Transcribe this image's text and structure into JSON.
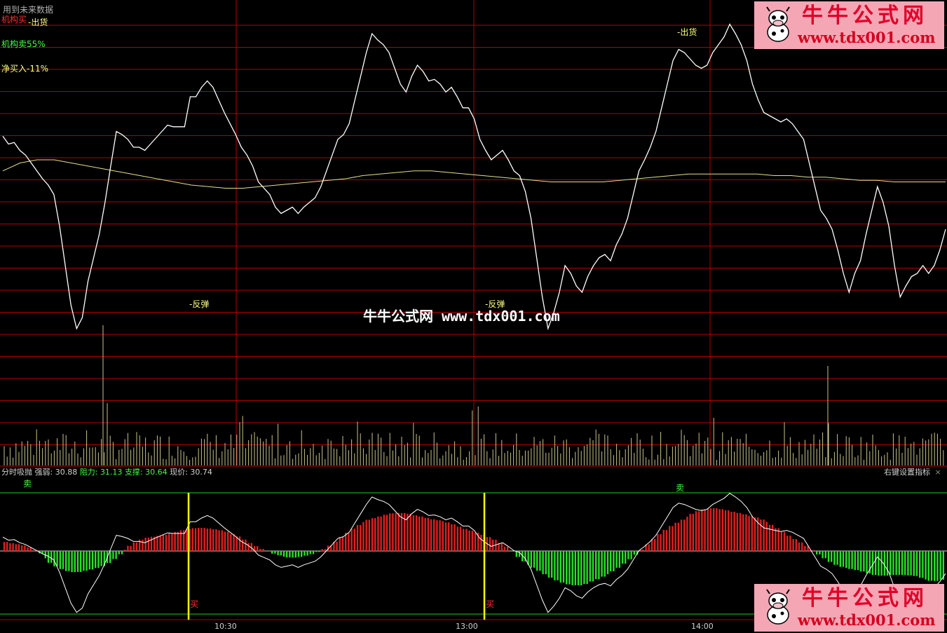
{
  "hint_text": "用到未来数据",
  "legend": {
    "inst_buy_label": "机构买",
    "inst_sell_label": "机构卖55%",
    "net_buy_label": "净买入-11%"
  },
  "signals": {
    "sell_top": "出货",
    "sell_left": "出货",
    "rebound1": "反弹",
    "rebound2": "反弹"
  },
  "watermark": "牛牛公式网 www.tdx001.com",
  "logo": {
    "cn": "牛牛公式网",
    "url": "www.tdx001.com"
  },
  "indicator": {
    "name": "分时吸抛",
    "strength_label": "强弱:",
    "strength_value": "30.88",
    "resistance_label": "阻力:",
    "resistance_value": "31.13",
    "support_label": "支撑:",
    "support_value": "30.64",
    "price_label": "现价:",
    "price_value": "30.74",
    "right_menu": "右键设置指标",
    "close_symbol": "×",
    "sell_mark": "卖",
    "buy_mark": "买"
  },
  "colors": {
    "grid": "#b40000",
    "price": "#ffffff",
    "avg": "#e6e08c",
    "volume": "#c8c48a",
    "bar_up": "#e02020",
    "bar_down": "#28e028",
    "band": "#20d020",
    "signal_line": "#ffff00",
    "label_yellow": "#ffff80",
    "label_green": "#40ff40",
    "label_red": "#ff3030"
  },
  "chart_data": {
    "type": "line",
    "x_ticks": [
      "10:30",
      "13:00",
      "14:00"
    ],
    "price_series_norm": [
      0.27,
      0.22,
      0.23,
      0.18,
      0.15,
      0.1,
      0.05,
      0.0,
      -0.04,
      -0.1,
      -0.3,
      -0.55,
      -0.8,
      -0.95,
      -0.88,
      -0.65,
      -0.5,
      -0.35,
      -0.15,
      0.08,
      0.3,
      0.28,
      0.25,
      0.2,
      0.2,
      0.18,
      0.22,
      0.26,
      0.3,
      0.34,
      0.33,
      0.33,
      0.33,
      0.52,
      0.52,
      0.58,
      0.62,
      0.58,
      0.5,
      0.42,
      0.35,
      0.28,
      0.2,
      0.15,
      0.08,
      -0.02,
      -0.06,
      -0.1,
      -0.18,
      -0.22,
      -0.2,
      -0.18,
      -0.22,
      -0.18,
      -0.15,
      -0.12,
      -0.05,
      0.05,
      0.15,
      0.25,
      0.28,
      0.35,
      0.5,
      0.65,
      0.8,
      0.92,
      0.88,
      0.85,
      0.8,
      0.7,
      0.6,
      0.55,
      0.65,
      0.72,
      0.68,
      0.62,
      0.63,
      0.6,
      0.55,
      0.58,
      0.52,
      0.45,
      0.45,
      0.38,
      0.25,
      0.18,
      0.12,
      0.15,
      0.18,
      0.12,
      0.05,
      0.02,
      -0.08,
      -0.25,
      -0.5,
      -0.75,
      -0.95,
      -0.85,
      -0.72,
      -0.55,
      -0.6,
      -0.68,
      -0.72,
      -0.62,
      -0.55,
      -0.5,
      -0.48,
      -0.52,
      -0.42,
      -0.35,
      -0.25,
      -0.1,
      0.05,
      0.12,
      0.2,
      0.3,
      0.45,
      0.6,
      0.75,
      0.82,
      0.8,
      0.76,
      0.72,
      0.7,
      0.72,
      0.8,
      0.85,
      0.9,
      0.98,
      0.92,
      0.85,
      0.75,
      0.6,
      0.5,
      0.42,
      0.4,
      0.38,
      0.36,
      0.38,
      0.35,
      0.3,
      0.25,
      0.1,
      -0.05,
      -0.2,
      -0.25,
      -0.32,
      -0.45,
      -0.6,
      -0.72,
      -0.6,
      -0.52,
      -0.35,
      -0.2,
      -0.05,
      -0.15,
      -0.3,
      -0.55,
      -0.75,
      -0.68,
      -0.62,
      -0.6,
      -0.55,
      -0.6,
      -0.55,
      -0.45,
      -0.32
    ],
    "avg_series_norm": [
      0.05,
      0.1,
      0.12,
      0.12,
      0.1,
      0.08,
      0.06,
      0.04,
      0.02,
      0.0,
      -0.02,
      -0.04,
      -0.05,
      -0.06,
      -0.06,
      -0.05,
      -0.04,
      -0.03,
      -0.02,
      -0.01,
      0.0,
      0.02,
      0.03,
      0.04,
      0.05,
      0.05,
      0.04,
      0.03,
      0.02,
      0.01,
      0.0,
      -0.01,
      -0.02,
      -0.02,
      -0.02,
      -0.02,
      -0.01,
      0.0,
      0.01,
      0.02,
      0.03,
      0.03,
      0.03,
      0.03,
      0.03,
      0.02,
      0.02,
      0.01,
      0.01,
      0.0,
      -0.01,
      -0.01,
      -0.02,
      -0.02,
      -0.02,
      -0.02
    ]
  }
}
